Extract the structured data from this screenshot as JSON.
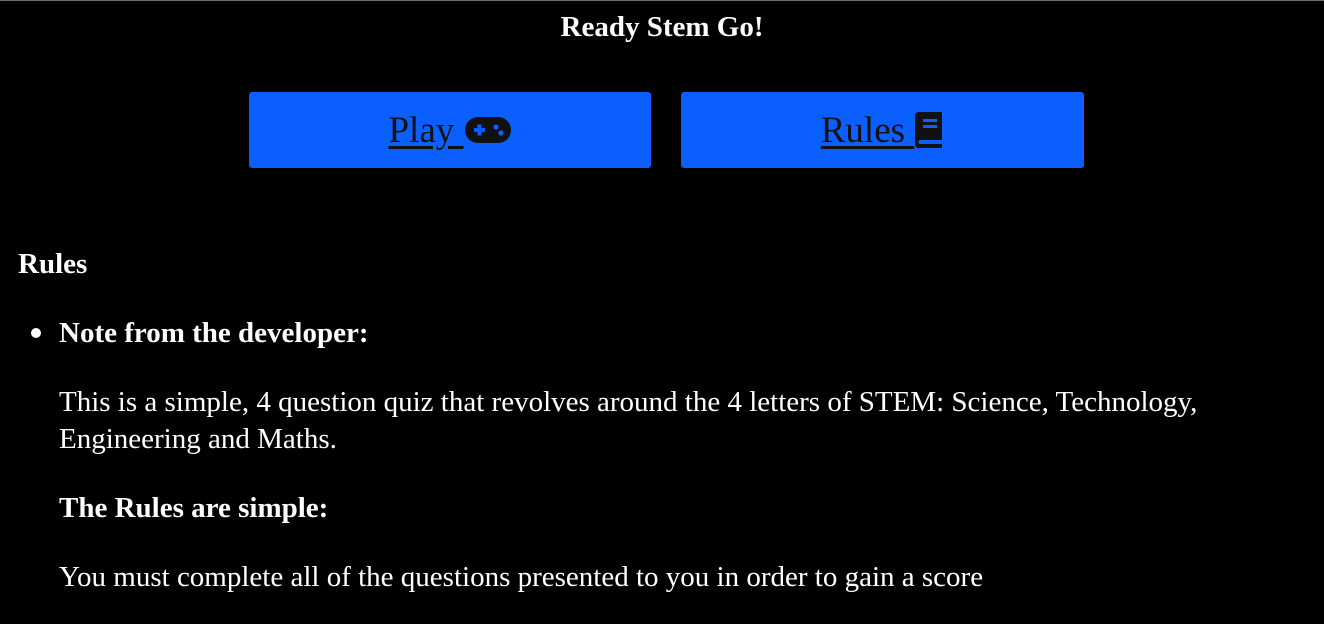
{
  "header": {
    "title": "Ready Stem Go!"
  },
  "buttons": {
    "play_label": "Play ",
    "play_icon": "gamepad-icon",
    "rules_label": "Rules ",
    "rules_icon": "book-icon",
    "color": "#0b5fff"
  },
  "rules": {
    "heading": "Rules",
    "items": [
      {
        "heading": "Note from the developer:",
        "intro": "This is a simple, 4 question quiz that revolves around the 4 letters of STEM: Science, Technology, Engineering and Maths.",
        "subheading": "The Rules are simple:",
        "rule": "You must complete all of the questions presented to you in order to gain a score"
      }
    ]
  }
}
